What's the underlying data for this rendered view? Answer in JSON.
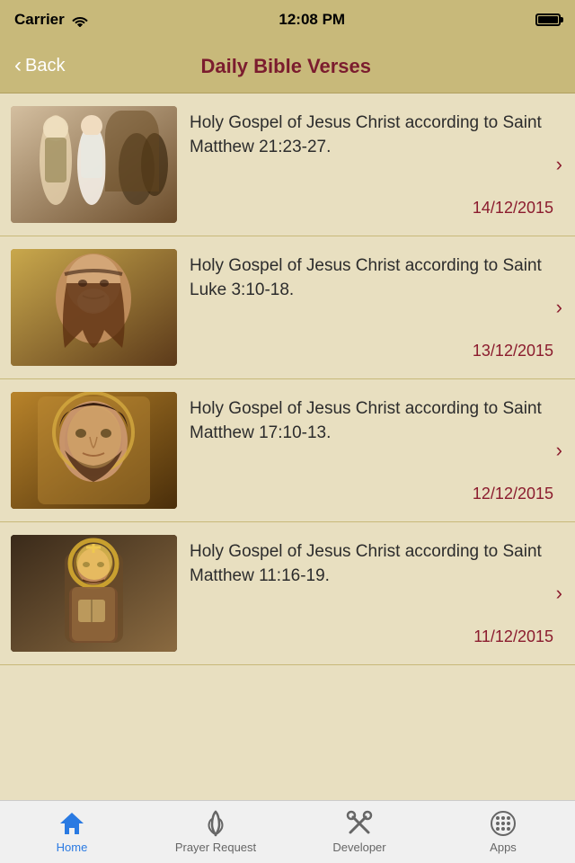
{
  "statusBar": {
    "carrier": "Carrier",
    "time": "12:08 PM"
  },
  "navBar": {
    "backLabel": "Back",
    "title": "Daily Bible Verses"
  },
  "listItems": [
    {
      "id": 1,
      "title": "Holy Gospel of Jesus Christ according to Saint Matthew 21:23-27.",
      "date": "14/12/2015",
      "thumbClass": "thumb-1"
    },
    {
      "id": 2,
      "title": "Holy Gospel of Jesus Christ according to Saint Luke 3:10-18.",
      "date": "13/12/2015",
      "thumbClass": "thumb-2"
    },
    {
      "id": 3,
      "title": "Holy Gospel of Jesus Christ according to Saint Matthew 17:10-13.",
      "date": "12/12/2015",
      "thumbClass": "thumb-3"
    },
    {
      "id": 4,
      "title": "Holy Gospel of Jesus Christ according to Saint Matthew 11:16-19.",
      "date": "11/12/2015",
      "thumbClass": "thumb-4"
    }
  ],
  "tabBar": {
    "items": [
      {
        "id": "home",
        "label": "Home",
        "active": true
      },
      {
        "id": "prayer",
        "label": "Prayer Request",
        "active": false
      },
      {
        "id": "developer",
        "label": "Developer",
        "active": false
      },
      {
        "id": "apps",
        "label": "Apps",
        "active": false
      }
    ]
  }
}
